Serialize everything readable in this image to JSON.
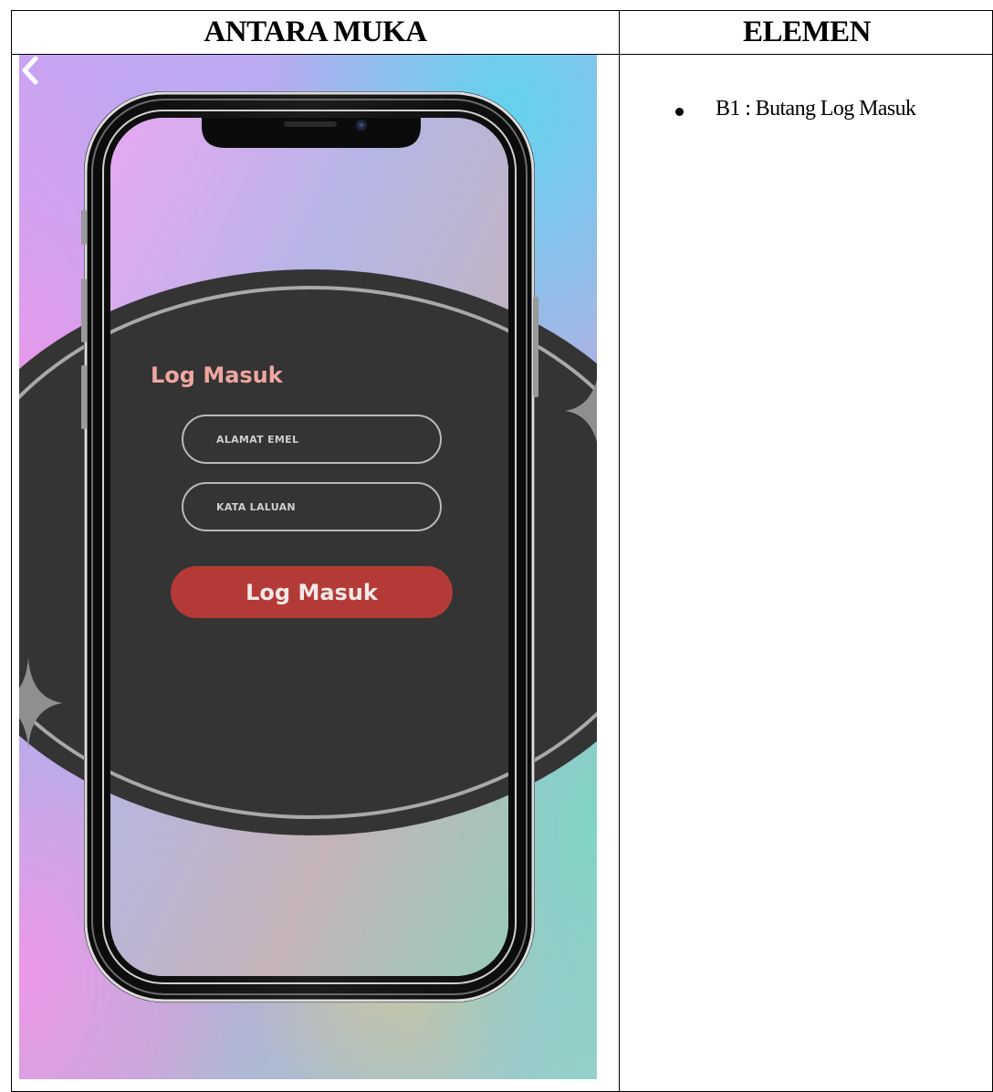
{
  "table": {
    "header_left": "ANTARA MUKA",
    "header_right": "ELEMEN"
  },
  "screen": {
    "title": "Log Masuk",
    "email_placeholder": "ALAMAT EMEL",
    "password_placeholder": "KATA LALUAN",
    "login_button": "Log Masuk",
    "back_icon": "chevron-left-icon",
    "colors": {
      "dark_panel": "#343434",
      "button": "#b43a37",
      "title": "#f0a6a0"
    }
  },
  "elements": [
    {
      "label": "B1 : Butang Log Masuk"
    }
  ]
}
